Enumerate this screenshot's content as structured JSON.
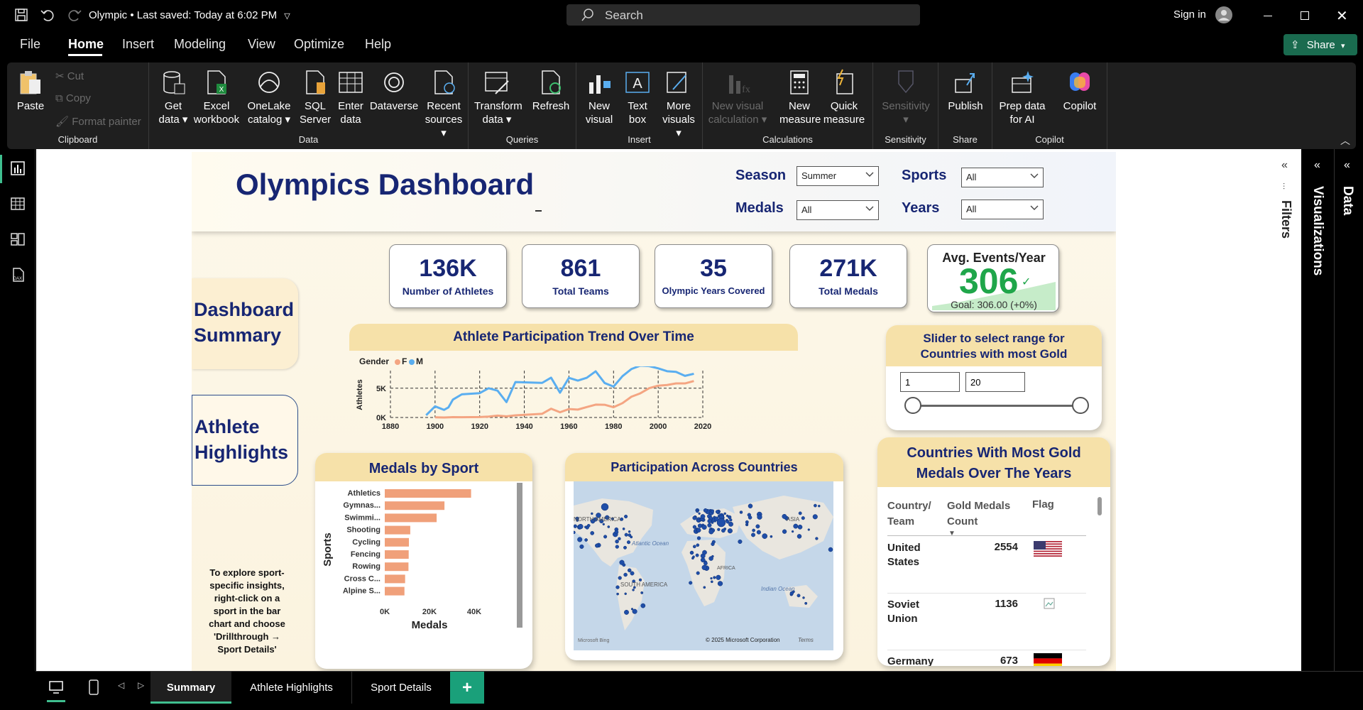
{
  "titlebar": {
    "title": "Olympic",
    "saved": "Last saved: Today at 6:02 PM",
    "search_placeholder": "Search",
    "sign_in": "Sign in"
  },
  "menu": {
    "items": [
      "File",
      "Home",
      "Insert",
      "Modeling",
      "View",
      "Optimize",
      "Help"
    ],
    "active": "Home",
    "share": "Share"
  },
  "ribbon": {
    "clipboard": {
      "paste": "Paste",
      "cut": "Cut",
      "copy": "Copy",
      "format_painter": "Format painter",
      "label": "Clipboard"
    },
    "data": {
      "get_data": "Get data",
      "excel": "Excel workbook",
      "onelake": "OneLake catalog",
      "sql": "SQL Server",
      "enter": "Enter data",
      "dataverse": "Dataverse",
      "recent": "Recent sources",
      "label": "Data"
    },
    "queries": {
      "transform": "Transform data",
      "refresh": "Refresh",
      "label": "Queries"
    },
    "insert": {
      "new_visual": "New visual",
      "text_box": "Text box",
      "more": "More visuals",
      "label": "Insert"
    },
    "calc": {
      "new_visual_calc": "New visual calculation",
      "new_measure": "New measure",
      "quick_measure": "Quick measure",
      "label": "Calculations"
    },
    "sensitivity": {
      "btn": "Sensitivity",
      "label": "Sensitivity"
    },
    "share": {
      "publish": "Publish",
      "label": "Share"
    },
    "copilot": {
      "prep": "Prep data for AI",
      "copilot": "Copilot",
      "label": "Copilot"
    }
  },
  "report": {
    "title": "Olympics Dashboard",
    "slicers": {
      "season": {
        "label": "Season",
        "value": "Summer"
      },
      "sports": {
        "label": "Sports",
        "value": "All"
      },
      "medals": {
        "label": "Medals",
        "value": "All"
      },
      "years": {
        "label": "Years",
        "value": "All"
      }
    },
    "kpis": [
      {
        "value": "136K",
        "label": "Number of Athletes"
      },
      {
        "value": "861",
        "label": "Total Teams"
      },
      {
        "value": "35",
        "label": "Olympic Years Covered"
      },
      {
        "value": "271K",
        "label": "Total Medals"
      }
    ],
    "avg_card": {
      "title": "Avg. Events/Year",
      "value": "306",
      "goal": "Goal: 306.00 (+0%)"
    },
    "nav": {
      "summary": "Dashboard Summary",
      "athlete": "Athlete Highlights"
    },
    "hint": "To explore sport-specific insights, right-click on a sport in the bar chart and choose 'Drillthrough → Sport Details'",
    "map_title": "Participation Across Countries",
    "map_labels": {
      "na": "NORTH AMERICA",
      "sa": "SOUTH AMERICA",
      "asia": "ASIA",
      "africa": "AFRICA",
      "atlantic": "Atlantic Ocean",
      "indian": "Indian Ocean",
      "bing": "Microsoft Bing",
      "copyright": "© 2025 Microsoft Corporation",
      "terms": "Terms"
    },
    "slider": {
      "title": "Slider to select range for Countries with most Gold",
      "min": "1",
      "max": "20",
      "min_value": 1,
      "max_value": 20
    },
    "gold_table": {
      "title": "Countries With Most Gold Medals Over The Years",
      "headers": [
        "Country/ Team",
        "Gold Medals Count",
        "Flag"
      ],
      "rows": [
        {
          "country": "United States",
          "count": "2554",
          "flag": "us"
        },
        {
          "country": "Soviet Union",
          "count": "1136",
          "flag": "broken"
        },
        {
          "country": "Germany",
          "count": "673",
          "flag": "de"
        }
      ]
    }
  },
  "pagetabs": {
    "tabs": [
      "Summary",
      "Athlete Highlights",
      "Sport Details"
    ],
    "active": "Summary",
    "add": "+"
  },
  "rightpane": {
    "filters": "Filters",
    "visualizations": "Visualizations",
    "data": "Data"
  },
  "chart_data": [
    {
      "type": "line",
      "title": "Athlete Participation Trend Over Time",
      "legend_title": "Gender",
      "xlabel": "",
      "ylabel": "Athletes",
      "xlim": [
        1880,
        2020
      ],
      "ylim": [
        0,
        8000
      ],
      "x_ticks": [
        "1880",
        "1900",
        "1920",
        "1940",
        "1960",
        "1980",
        "2000",
        "2020"
      ],
      "y_ticks": [
        "0K",
        "5K"
      ],
      "series": [
        {
          "name": "F",
          "color": "#f4a582",
          "x": [
            1900,
            1904,
            1908,
            1912,
            1920,
            1924,
            1928,
            1932,
            1936,
            1948,
            1952,
            1956,
            1960,
            1964,
            1968,
            1972,
            1976,
            1980,
            1984,
            1988,
            1992,
            1996,
            2000,
            2004,
            2008,
            2012,
            2016
          ],
          "y": [
            23,
            6,
            55,
            53,
            78,
            156,
            312,
            201,
            361,
            628,
            1497,
            893,
            1435,
            1348,
            1777,
            2193,
            2172,
            1756,
            2447,
            3543,
            4124,
            5008,
            5431,
            5546,
            5816,
            5815,
            6223
          ]
        },
        {
          "name": "M",
          "color": "#5aaef0",
          "x": [
            1896,
            1900,
            1904,
            1906,
            1908,
            1912,
            1920,
            1924,
            1928,
            1932,
            1936,
            1948,
            1952,
            1956,
            1960,
            1964,
            1968,
            1972,
            1976,
            1980,
            1984,
            1988,
            1992,
            1996,
            2000,
            2004,
            2008,
            2012,
            2016
          ],
          "y": [
            380,
            1900,
            1300,
            1722,
            3054,
            3953,
            4158,
            4989,
            4588,
            2622,
            6038,
            5910,
            6797,
            4234,
            6767,
            6298,
            6776,
            7882,
            5888,
            5276,
            7054,
            8270,
            8853,
            8772,
            8390,
            7897,
            7786,
            7105,
            7465
          ]
        }
      ]
    },
    {
      "type": "bar",
      "title": "Medals by Sport",
      "xlabel": "Medals",
      "ylabel": "Sports",
      "xlim": [
        0,
        40000
      ],
      "x_ticks": [
        "0K",
        "20K",
        "40K"
      ],
      "categories": [
        "Athletics",
        "Gymnas...",
        "Swimmi...",
        "Shooting",
        "Cycling",
        "Fencing",
        "Rowing",
        "Cross C...",
        "Alpine S..."
      ],
      "values": [
        38600,
        26700,
        23200,
        11400,
        10800,
        10700,
        10600,
        9100,
        8800
      ],
      "color": "#f0a07a"
    }
  ]
}
